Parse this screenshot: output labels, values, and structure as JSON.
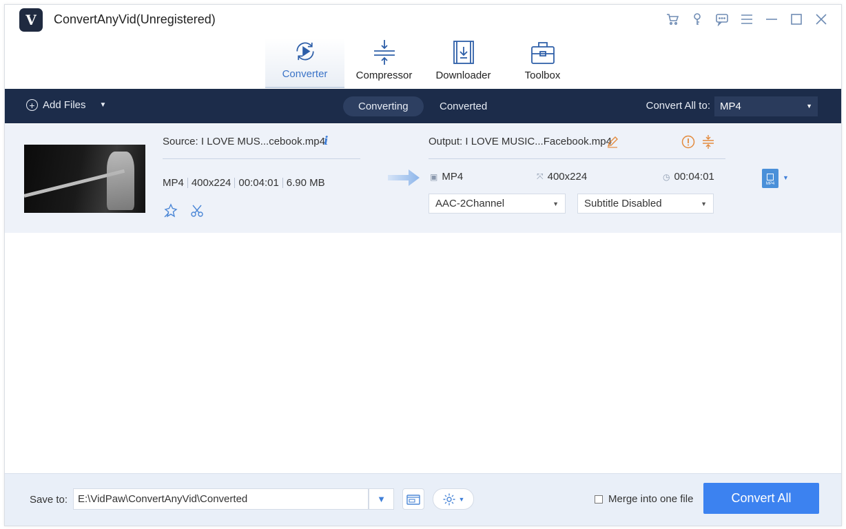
{
  "app": {
    "title": "ConvertAnyVid(Unregistered)",
    "logo_letter": "V"
  },
  "window_controls": [
    "cart-icon",
    "key-icon",
    "chat-icon",
    "menu-icon",
    "minimize-icon",
    "maximize-icon",
    "close-icon"
  ],
  "modules": [
    {
      "label": "Converter",
      "active": true
    },
    {
      "label": "Compressor",
      "active": false
    },
    {
      "label": "Downloader",
      "active": false
    },
    {
      "label": "Toolbox",
      "active": false
    }
  ],
  "toolbar": {
    "add_files": "Add Files",
    "tabs": [
      {
        "label": "Converting",
        "active": true
      },
      {
        "label": "Converted",
        "active": false
      }
    ],
    "convert_all_label": "Convert All to:",
    "convert_all_format": "MP4"
  },
  "file": {
    "source": "Source: I LOVE MUS...cebook.mp4",
    "format": "MP4",
    "resolution": "400x224",
    "duration": "00:04:01",
    "size": "6.90 MB",
    "output": "Output: I LOVE MUSIC...Facebook.mp4",
    "out_format": "MP4",
    "out_resolution": "400x224",
    "out_duration": "00:04:01",
    "audio": "AAC-2Channel",
    "subtitle": "Subtitle Disabled",
    "badge_text": "MP4"
  },
  "footer": {
    "save_label": "Save to:",
    "save_path": "E:\\VidPaw\\ConvertAnyVid\\Converted",
    "merge_label": "Merge into one file",
    "convert_button": "Convert All"
  },
  "colors": {
    "accent": "#3c82f0",
    "toolbar_bg": "#1c2c4a",
    "row_bg": "#eef2f9"
  }
}
